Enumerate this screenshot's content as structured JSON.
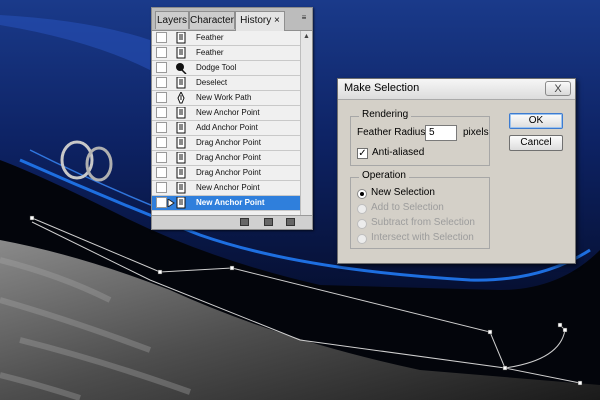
{
  "panel": {
    "tabs": [
      "Layers",
      "Character",
      "History ×"
    ],
    "menu_icon": "panel-menu-icon",
    "history_items": [
      {
        "label": "Feather",
        "icon": "document-icon"
      },
      {
        "label": "Feather",
        "icon": "document-icon"
      },
      {
        "label": "Dodge Tool",
        "icon": "dodge-tool-icon"
      },
      {
        "label": "Deselect",
        "icon": "document-icon"
      },
      {
        "label": "New Work Path",
        "icon": "pen-tool-icon"
      },
      {
        "label": "New Anchor Point",
        "icon": "document-icon"
      },
      {
        "label": "Add Anchor Point",
        "icon": "document-icon"
      },
      {
        "label": "Drag Anchor Point",
        "icon": "document-icon"
      },
      {
        "label": "Drag Anchor Point",
        "icon": "document-icon"
      },
      {
        "label": "Drag Anchor Point",
        "icon": "document-icon"
      },
      {
        "label": "New Anchor Point",
        "icon": "document-icon"
      },
      {
        "label": "New Anchor Point",
        "icon": "document-icon",
        "selected": true
      }
    ],
    "selected_color": "#2f7fdc",
    "footer_icons": [
      "new-document-from-state-icon",
      "new-snapshot-icon",
      "delete-state-icon"
    ]
  },
  "dialog": {
    "title": "Make Selection",
    "close_label": "X",
    "rendering": {
      "title": "Rendering",
      "feather_label": "Feather Radius:",
      "feather_value": "5",
      "feather_unit": "pixels",
      "anti_aliased_label": "Anti-aliased",
      "anti_aliased_checked": true,
      "check_mark": "✓"
    },
    "operation": {
      "title": "Operation",
      "options": [
        {
          "label": "New Selection",
          "selected": true,
          "enabled": true
        },
        {
          "label": "Add to Selection",
          "selected": false,
          "enabled": false
        },
        {
          "label": "Subtract from Selection",
          "selected": false,
          "enabled": false
        },
        {
          "label": "Intersect with Selection",
          "selected": false,
          "enabled": false
        }
      ]
    },
    "ok_label": "OK",
    "cancel_label": "Cancel"
  },
  "canvas": {
    "accent_blue": "#1e6fe0",
    "background_dark": "#05070d"
  }
}
